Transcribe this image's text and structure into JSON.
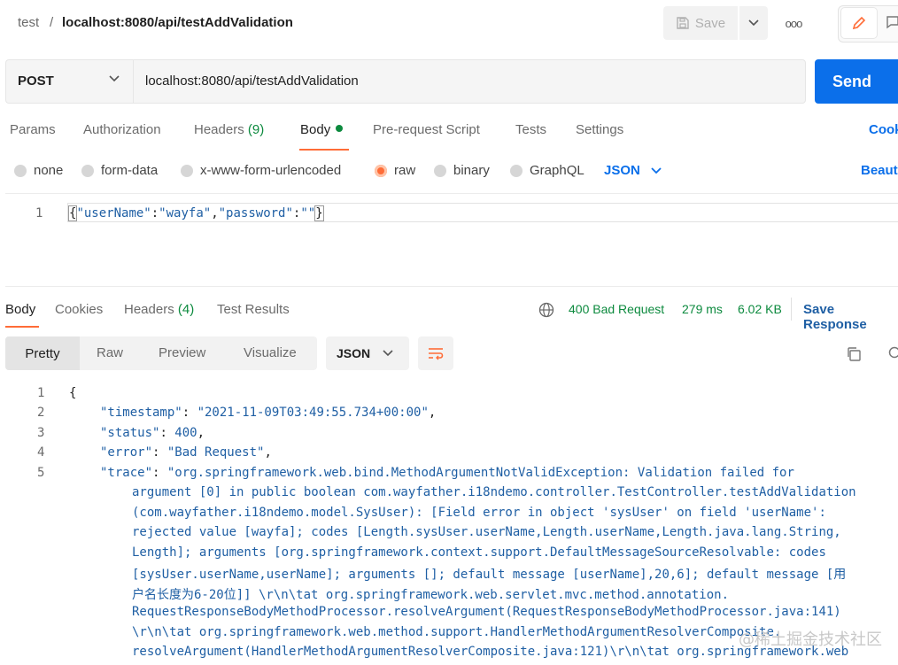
{
  "breadcrumb": {
    "collection": "test",
    "separator": "/",
    "request": "localhost:8080/api/testAddValidation"
  },
  "toolbar": {
    "save_label": "Save",
    "more_label": "ooo"
  },
  "request": {
    "method": "POST",
    "url": "localhost:8080/api/testAddValidation",
    "send_label": "Send"
  },
  "request_tabs": {
    "params": "Params",
    "authorization": "Authorization",
    "headers": "Headers",
    "headers_count": "(9)",
    "body": "Body",
    "prerequest": "Pre-request Script",
    "tests": "Tests",
    "settings": "Settings",
    "cookies": "Cookies"
  },
  "body_types": {
    "none": "none",
    "form_data": "form-data",
    "urlencoded": "x-www-form-urlencoded",
    "raw": "raw",
    "binary": "binary",
    "graphql": "GraphQL",
    "format": "JSON",
    "beautify": "Beautify"
  },
  "request_body": {
    "line_number": "1",
    "open": "{",
    "key1": "\"userName\"",
    "colon1": ":",
    "val1": "\"wayfa\"",
    "comma": ",",
    "key2": "\"password\"",
    "colon2": ":",
    "val2": "\"\"",
    "close": "}"
  },
  "response_tabs": {
    "body": "Body",
    "cookies": "Cookies",
    "headers": "Headers",
    "headers_count": "(4)",
    "test_results": "Test Results"
  },
  "response_status": {
    "status": "400 Bad Request",
    "time": "279 ms",
    "size": "6.02 KB",
    "save_response": "Save Response"
  },
  "view_modes": {
    "pretty": "Pretty",
    "raw": "Raw",
    "preview": "Preview",
    "visualize": "Visualize",
    "format": "JSON"
  },
  "response_body": {
    "line_numbers": [
      "1",
      "2",
      "3",
      "4",
      "5"
    ],
    "open_brace": "{",
    "timestamp_key": "\"timestamp\"",
    "timestamp_val": "\"2021-11-09T03:49:55.734+00:00\"",
    "status_key": "\"status\"",
    "status_val": "400",
    "error_key": "\"error\"",
    "error_val": "\"Bad Request\"",
    "trace_key": "\"trace\"",
    "trace_lines": [
      "\"org.springframework.web.bind.MethodArgumentNotValidException: Validation failed for",
      "argument [0] in public boolean com.wayfather.i18ndemo.controller.TestController.testAddValidation",
      "(com.wayfather.i18ndemo.model.SysUser): [Field error in object 'sysUser' on field 'userName':",
      "rejected value [wayfa]; codes [Length.sysUser.userName,Length.userName,Length.java.lang.String,",
      "Length]; arguments [org.springframework.context.support.DefaultMessageSourceResolvable: codes",
      "[sysUser.userName,userName]; arguments []; default message [userName],20,6]; default message [用",
      "户名长度为6-20位]] \\r\\n\\tat org.springframework.web.servlet.mvc.method.annotation.",
      "RequestResponseBodyMethodProcessor.resolveArgument(RequestResponseBodyMethodProcessor.java:141)",
      "\\r\\n\\tat org.springframework.web.method.support.HandlerMethodArgumentResolverComposite.",
      "resolveArgument(HandlerMethodArgumentResolverComposite.java:121)\\r\\n\\tat org.springframework.web"
    ]
  },
  "watermark": "@稀土掘金技术社区",
  "colors": {
    "accent": "#ff6c37",
    "primary": "#0b6fea",
    "success": "#0c8a3e",
    "code": "#1f5fa4"
  }
}
